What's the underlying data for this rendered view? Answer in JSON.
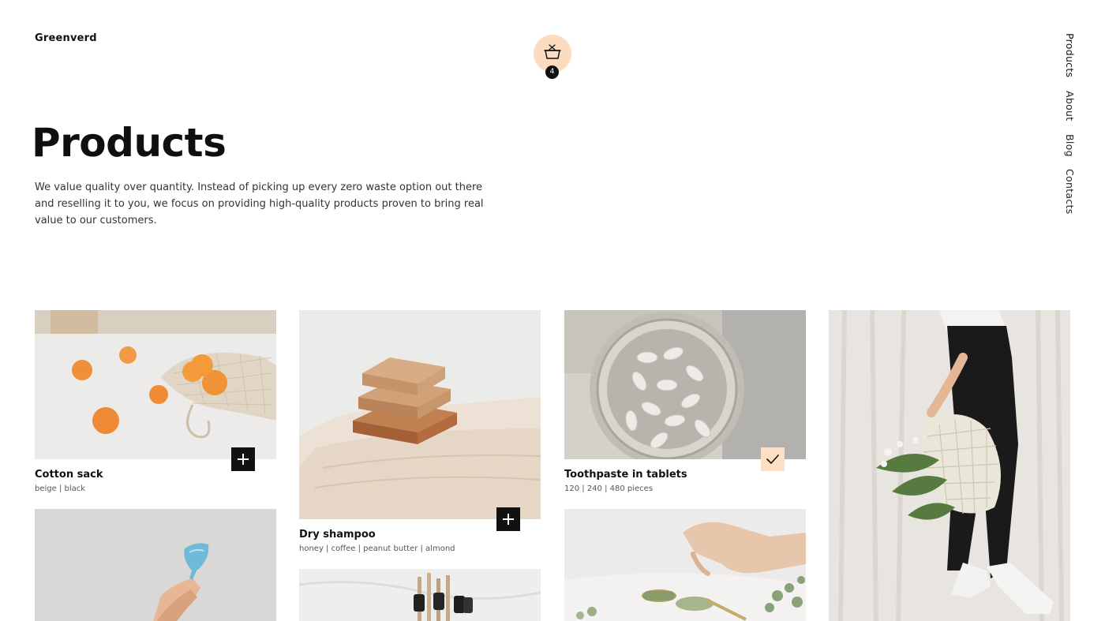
{
  "brand": {
    "name": "Greenverd"
  },
  "cart": {
    "count": "4",
    "icon": "basket-icon",
    "accent": "#fcdcc0"
  },
  "nav": {
    "items": [
      "Products",
      "About",
      "Blog",
      "Contacts"
    ]
  },
  "page": {
    "title": "Products",
    "intro": "We value quality over quantity. Instead of picking up every zero waste option out there and reselling it to you, we focus on providing high-quality products proven to bring real value to our customers."
  },
  "products": [
    {
      "name": "Cotton sack",
      "variants": "beige | black",
      "action": "add",
      "icon": "plus-icon"
    },
    {
      "name": "Dry shampoo",
      "variants": "honey | coffee | peanut butter | almond",
      "action": "add",
      "icon": "plus-icon"
    },
    {
      "name": "Toothpaste in tablets",
      "variants": "120 | 240 | 480 pieces",
      "action": "added",
      "icon": "check-icon"
    }
  ],
  "colors": {
    "text": "#111111",
    "accent": "#fcdcc0",
    "button": "#111111"
  }
}
